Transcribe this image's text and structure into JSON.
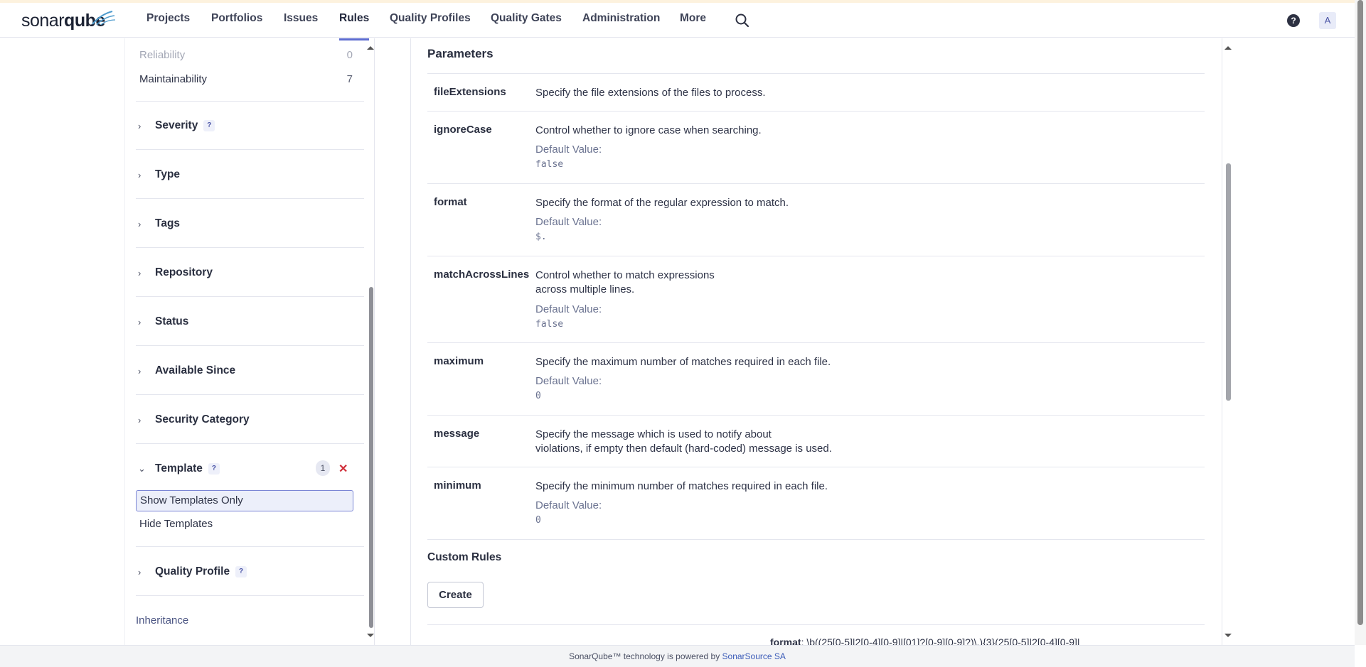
{
  "nav": {
    "logo_sonar": "sonar",
    "logo_qube": "qube",
    "items": [
      {
        "label": "Projects"
      },
      {
        "label": "Portfolios"
      },
      {
        "label": "Issues"
      },
      {
        "label": "Rules",
        "active": true
      },
      {
        "label": "Quality Profiles"
      },
      {
        "label": "Quality Gates"
      },
      {
        "label": "Administration"
      },
      {
        "label": "More"
      }
    ],
    "help_glyph": "?",
    "avatar_letter": "A",
    "accent_color": "#5d6cd0"
  },
  "sidebar": {
    "facet_values": [
      {
        "label": "Reliability",
        "count": "0",
        "muted": true
      },
      {
        "label": "Maintainability",
        "count": "7"
      }
    ],
    "facets": [
      {
        "label": "Severity",
        "has_help": true
      },
      {
        "label": "Type"
      },
      {
        "label": "Tags"
      },
      {
        "label": "Repository"
      },
      {
        "label": "Status"
      },
      {
        "label": "Available Since"
      },
      {
        "label": "Security Category"
      }
    ],
    "template": {
      "label": "Template",
      "badge": "1",
      "clear": "✕",
      "options": [
        {
          "label": "Show Templates Only",
          "selected": true
        },
        {
          "label": "Hide Templates"
        }
      ]
    },
    "quality_profile": {
      "label": "Quality Profile"
    },
    "inheritance": "Inheritance",
    "help_glyph": "?"
  },
  "main": {
    "parameters_title": "Parameters",
    "default_value_label": "Default Value:",
    "params": [
      {
        "key": "fileExtensions",
        "desc": [
          "Specify the file extensions of the files to process."
        ]
      },
      {
        "key": "ignoreCase",
        "desc": [
          "Control whether to ignore case when searching."
        ],
        "default": "false"
      },
      {
        "key": "format",
        "desc": [
          "Specify the format of the regular expression to match."
        ],
        "default": "$."
      },
      {
        "key": "matchAcrossLines",
        "desc": [
          "Control whether to match expressions",
          "across multiple lines."
        ],
        "default": "false"
      },
      {
        "key": "maximum",
        "desc": [
          "Specify the maximum number of matches required in each file."
        ],
        "default": "0"
      },
      {
        "key": "message",
        "desc": [
          "Specify the message which is used to notify about",
          "violations, if empty then default (hard-coded) message is used."
        ]
      },
      {
        "key": "minimum",
        "desc": [
          "Specify the minimum number of matches required in each file."
        ],
        "default": "0"
      }
    ],
    "custom_rules_title": "Custom Rules",
    "create_label": "Create",
    "cutoff_key": "format",
    "cutoff_value": ": \\b((25[0-5]|2[0-4][0-9]|[01]?[0-9][0-9]?)\\.){3}(25[0-5]|2[0-4][0-9]|"
  },
  "footer": {
    "text": "SonarQube™ technology is powered by ",
    "link": "SonarSource SA"
  }
}
